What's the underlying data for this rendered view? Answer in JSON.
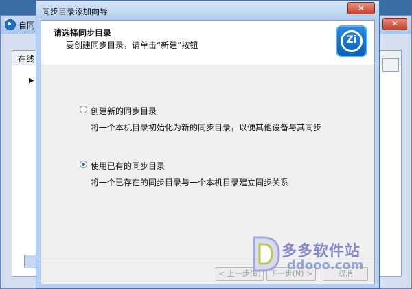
{
  "background_window": {
    "title": "自同",
    "header_label": "在线",
    "close_glyph": "✕"
  },
  "dialog": {
    "title": "同步目录添加向导",
    "close_glyph": "✕",
    "header": {
      "title": "请选择同步目录",
      "subtitle": "要创建同步目录，请单击“新建”按钮",
      "icon_text": "Zi"
    },
    "options": [
      {
        "label": "创建新的同步目录",
        "description": "将一个本机目录初始化为新的同步目录，以便其他设备与其同步",
        "selected": false
      },
      {
        "label": "使用已有的同步目录",
        "description": "将一个已存在的同步目录与一个本机目录建立同步关系",
        "selected": true
      }
    ],
    "buttons": {
      "back": "< 上一步(B)",
      "next": "下一步(N) >",
      "cancel": "取消"
    }
  },
  "watermark": {
    "name": "多多软件站",
    "url": "ddooo.com"
  },
  "colors": {
    "accent": "#2c6fd1",
    "title_bar": "#b3cdef",
    "close_button": "#c7402a"
  }
}
